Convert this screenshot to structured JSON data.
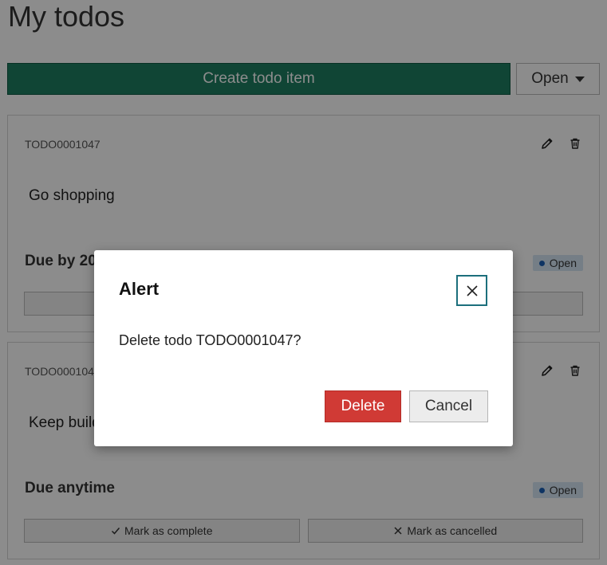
{
  "page": {
    "title": "My todos"
  },
  "toolbar": {
    "create_label": "Create todo item",
    "filter_label": "Open"
  },
  "todos": [
    {
      "id": "TODO0001047",
      "text": "Go shopping",
      "due": "Due by 202",
      "status": "Open",
      "complete_label": "",
      "cancel_label": ""
    },
    {
      "id": "TODO0001046",
      "text": "Keep build",
      "due": "Due anytime",
      "status": "Open",
      "complete_label": "Mark as complete",
      "cancel_label": "Mark as cancelled"
    }
  ],
  "modal": {
    "title": "Alert",
    "message": "Delete todo TODO0001047?",
    "delete_label": "Delete",
    "cancel_label": "Cancel"
  },
  "icons": {
    "edit": "pencil-icon",
    "delete": "trash-icon",
    "close": "close-icon",
    "check": "check-icon",
    "x": "x-icon"
  },
  "colors": {
    "primary": "#1e7f62",
    "danger": "#d03a35",
    "status_badge": "#d6e6f5",
    "focus_ring": "#1c6f7c"
  }
}
